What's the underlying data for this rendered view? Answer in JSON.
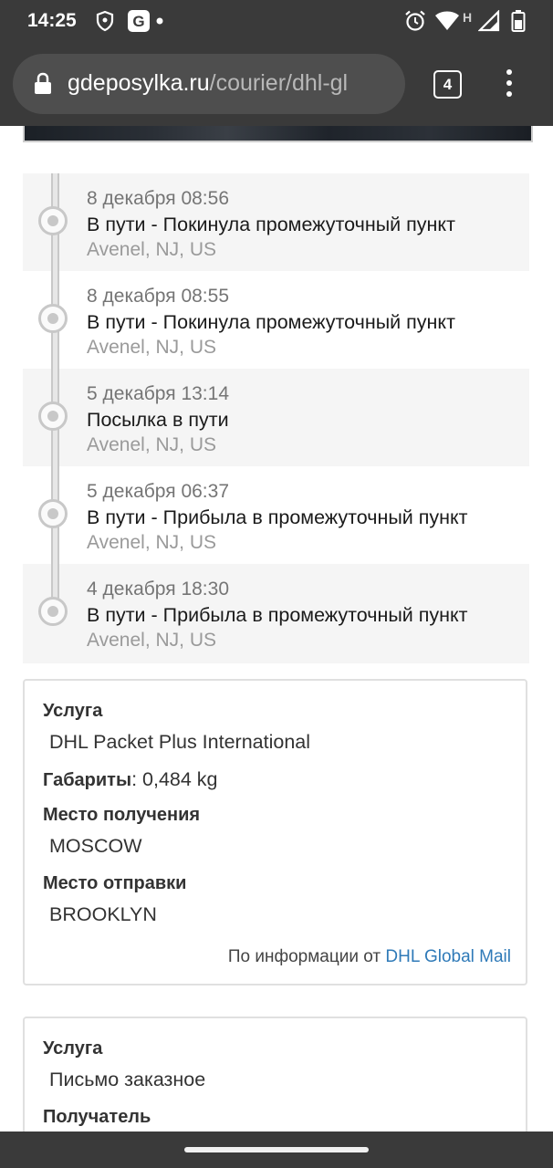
{
  "status_bar": {
    "time": "14:25",
    "icons": [
      "shield-icon",
      "g-app-icon",
      "dot-icon",
      "alarm-icon",
      "wifi-icon",
      "h-signal-icon",
      "battery-icon"
    ],
    "network_letter": "H"
  },
  "browser": {
    "url_domain": "gdeposylka.ru",
    "url_path": "/courier/dhl-gl",
    "tab_count": "4"
  },
  "timeline": {
    "events": [
      {
        "date": "8 декабря 08:56",
        "status": "В пути - Покинула промежуточный пункт",
        "location": "Avenel, NJ, US"
      },
      {
        "date": "8 декабря 08:55",
        "status": "В пути - Покинула промежуточный пункт",
        "location": "Avenel, NJ, US"
      },
      {
        "date": "5 декабря 13:14",
        "status": "Посылка в пути",
        "location": "Avenel, NJ, US"
      },
      {
        "date": "5 декабря 06:37",
        "status": "В пути - Прибыла в промежуточный пункт",
        "location": "Avenel, NJ, US"
      },
      {
        "date": "4 декабря 18:30",
        "status": "В пути - Прибыла в промежуточный пункт",
        "location": "Avenel, NJ, US"
      }
    ]
  },
  "info_card": {
    "service_label": "Услуга",
    "service_value": "DHL Packet Plus International",
    "dimensions_label": "Габариты",
    "dimensions_value": "0,484 kg",
    "destination_label": "Место получения",
    "destination_value": "MOSCOW",
    "origin_label": "Место отправки",
    "origin_value": "BROOKLYN",
    "source_prefix": "По информации от",
    "source_link": "DHL Global Mail"
  },
  "info_card2": {
    "service_label": "Услуга",
    "service_value": "Письмо заказное",
    "recipient_label": "Получатель"
  }
}
